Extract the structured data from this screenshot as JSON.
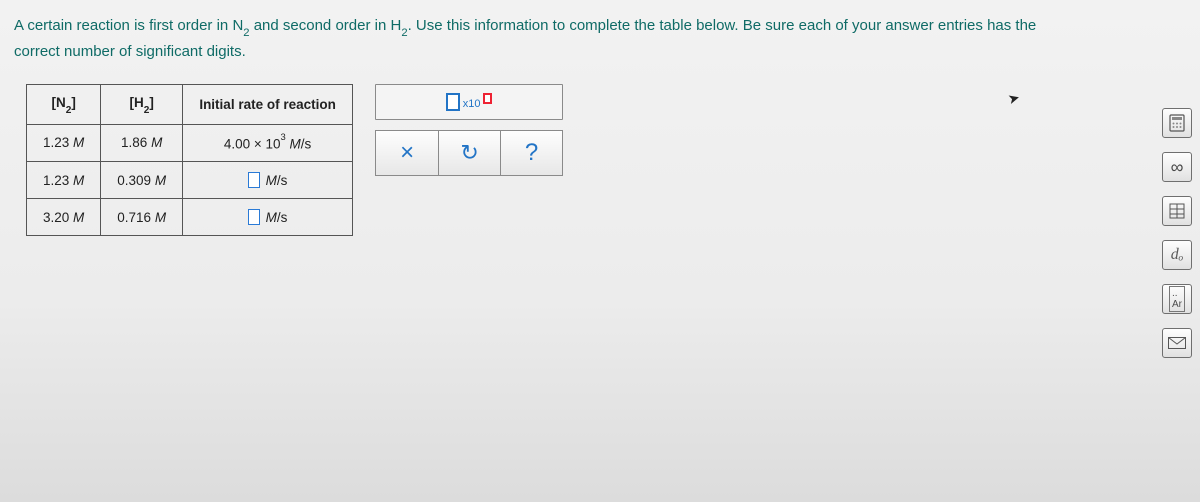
{
  "problem": {
    "line1_a": "A certain reaction is first order in ",
    "line1_b": " and second order in ",
    "line1_c": ". Use this information to complete the table below. Be sure each of your answer entries has the",
    "line2": "correct number of significant digits.",
    "species1_base": "N",
    "species1_sub": "2",
    "species2_base": "H",
    "species2_sub": "2"
  },
  "table": {
    "headers": {
      "col1_base": "N",
      "col1_sub": "2",
      "col2_base": "H",
      "col2_sub": "2",
      "col3": "Initial rate of reaction"
    },
    "rows": [
      {
        "n2": "1.23 ",
        "h2": "1.86 ",
        "unit_M": "M",
        "rate_val": "4.00 × 10",
        "rate_exp": "3",
        "rate_unit_M": "M",
        "rate_unit_s": "/s",
        "has_input": false
      },
      {
        "n2": "1.23 ",
        "h2": "0.309 ",
        "unit_M": "M",
        "rate_unit_M": "M",
        "rate_unit_s": "/s",
        "has_input": true
      },
      {
        "n2": "3.20 ",
        "h2": "0.716 ",
        "unit_M": "M",
        "rate_unit_M": "M",
        "rate_unit_s": "/s",
        "has_input": true
      }
    ]
  },
  "palette": {
    "sci_x10": "x10",
    "clear_label": "×",
    "reset_label": "↻",
    "help_label": "?"
  },
  "side_tools": {
    "calc_label": "calculator-icon",
    "infinity": "∞",
    "table_label": "table-icon",
    "doo": "dₒ",
    "periodic_label": "Ar",
    "mail_label": "mail-icon"
  }
}
